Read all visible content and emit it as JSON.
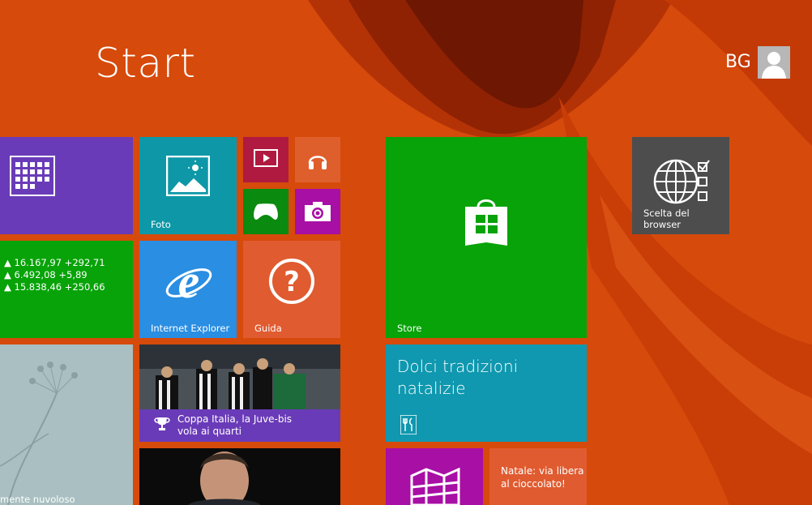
{
  "header": {
    "title": "Start",
    "user_initials": "BG"
  },
  "tiles": {
    "calendar": {
      "label": ""
    },
    "photos": {
      "label": "Foto"
    },
    "video": {
      "label": ""
    },
    "music": {
      "label": ""
    },
    "games": {
      "label": ""
    },
    "camera": {
      "label": ""
    },
    "finance": {
      "lines": [
        "▲ 16.167,97 +292,71",
        "▲ 6.492,08 +5,89",
        "▲ 15.838,46 +250,66"
      ]
    },
    "ie": {
      "label": "Internet Explorer"
    },
    "help": {
      "label": "Guida"
    },
    "store": {
      "label": "Store"
    },
    "browser_choice": {
      "label": "Scelta del browser"
    },
    "weather": {
      "label": "mente nuvoloso"
    },
    "sports": {
      "caption": "Coppa Italia, la Juve-bis vola ai quarti"
    },
    "food": {
      "title": "Dolci tradizioni natalizie"
    },
    "food_news": {
      "title": "Natale: via libera al cioccolato!"
    }
  },
  "colors": {
    "background": "#d64a0b",
    "calendar": "#6a3bb8",
    "photos": "#0e98a7",
    "video": "#b01a40",
    "music": "#df5f2c",
    "games": "#0a8a0f",
    "camera": "#a80fa5",
    "finance": "#07a308",
    "ie": "#2a8ee2",
    "help": "#e05b30",
    "store": "#07a308",
    "browser_choice": "#4d4d4d",
    "food": "#0f98af",
    "news_purple": "#6a3bb8"
  }
}
